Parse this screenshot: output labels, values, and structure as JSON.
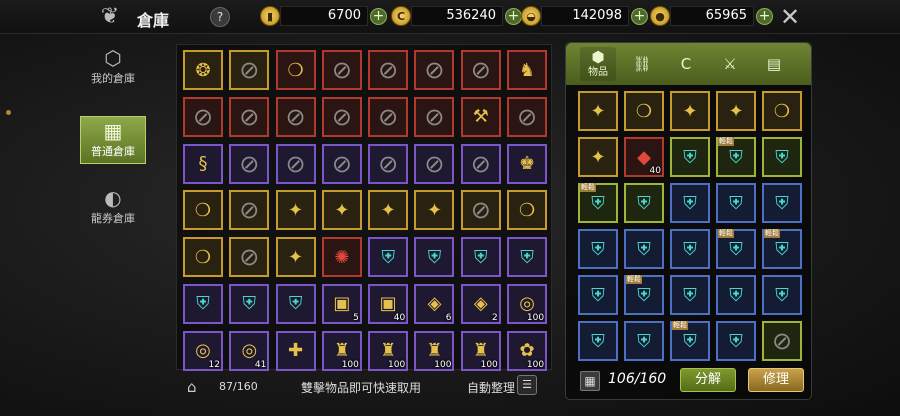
{
  "header": {
    "title": "倉庫",
    "help_label": "?",
    "close_label": "✕",
    "currencies": [
      {
        "icon": "gold-token-icon",
        "glyph": "▮",
        "value": "6700",
        "plus": "+"
      },
      {
        "icon": "c-coin-icon",
        "glyph": "C",
        "value": "536240",
        "plus": "+"
      },
      {
        "icon": "pouch-icon",
        "glyph": "◒",
        "value": "142098",
        "plus": "+"
      },
      {
        "icon": "gold-coin-icon",
        "glyph": "●",
        "value": "65965",
        "plus": "+"
      }
    ]
  },
  "sidebar": {
    "items": [
      {
        "label": "我的倉庫",
        "icon": "box-icon",
        "glyph": "⬡",
        "active": false
      },
      {
        "label": "普通倉庫",
        "icon": "warehouse-icon",
        "glyph": "▦",
        "active": true
      },
      {
        "label": "龍券倉庫",
        "icon": "dragon-coin-icon",
        "glyph": "◐",
        "active": false
      }
    ]
  },
  "storage": {
    "capacity": "87/160",
    "hint": "雙擊物品即可快速取用",
    "auto_sort": "自動整理",
    "home_glyph": "⌂",
    "list_glyph": "☰",
    "slots": [
      {
        "r": "gold",
        "g": "❂",
        "n": "armor-item"
      },
      {
        "r": "gold",
        "g": "⊘",
        "n": "unusable"
      },
      {
        "r": "red",
        "g": "❍",
        "n": "ring-item"
      },
      {
        "r": "red",
        "g": "⊘",
        "n": "unusable"
      },
      {
        "r": "red",
        "g": "⊘",
        "n": "unusable"
      },
      {
        "r": "red",
        "g": "⊘",
        "n": "unusable"
      },
      {
        "r": "red",
        "g": "⊘",
        "n": "unusable"
      },
      {
        "r": "red",
        "g": "♞",
        "n": "shoulder-item"
      },
      {
        "r": "red",
        "g": "⊘",
        "n": "unusable"
      },
      {
        "r": "red",
        "g": "⊘",
        "n": "unusable"
      },
      {
        "r": "red",
        "g": "⊘",
        "n": "unusable"
      },
      {
        "r": "red",
        "g": "⊘",
        "n": "unusable"
      },
      {
        "r": "red",
        "g": "⊘",
        "n": "unusable"
      },
      {
        "r": "red",
        "g": "⊘",
        "n": "unusable"
      },
      {
        "r": "red",
        "g": "⚒",
        "n": "axe-item"
      },
      {
        "r": "red",
        "g": "⊘",
        "n": "unusable"
      },
      {
        "r": "purple",
        "g": "§",
        "n": "earring-item"
      },
      {
        "r": "purple",
        "g": "⊘",
        "n": "unusable"
      },
      {
        "r": "purple",
        "g": "⊘",
        "n": "unusable"
      },
      {
        "r": "purple",
        "g": "⊘",
        "n": "unusable"
      },
      {
        "r": "purple",
        "g": "⊘",
        "n": "unusable"
      },
      {
        "r": "purple",
        "g": "⊘",
        "n": "unusable"
      },
      {
        "r": "purple",
        "g": "⊘",
        "n": "unusable"
      },
      {
        "r": "purple",
        "g": "♚",
        "n": "helm-item"
      },
      {
        "r": "gold",
        "g": "❍",
        "n": "ring-item"
      },
      {
        "r": "gold",
        "g": "⊘",
        "n": "unusable"
      },
      {
        "r": "gold",
        "g": "✦",
        "n": "earring-item"
      },
      {
        "r": "gold",
        "g": "✦",
        "n": "earring-item"
      },
      {
        "r": "gold",
        "g": "✦",
        "n": "earring-item"
      },
      {
        "r": "gold",
        "g": "✦",
        "n": "earring-item"
      },
      {
        "r": "gold",
        "g": "⊘",
        "n": "unusable"
      },
      {
        "r": "gold",
        "g": "❍",
        "n": "ring-item"
      },
      {
        "r": "gold",
        "g": "❍",
        "n": "ring-item"
      },
      {
        "r": "gold",
        "g": "⊘",
        "n": "unusable"
      },
      {
        "r": "gold",
        "g": "✦",
        "n": "earring-item"
      },
      {
        "r": "red",
        "g": "✺",
        "n": "orb-item"
      },
      {
        "r": "purple",
        "g": "⛨",
        "n": "jewel-item"
      },
      {
        "r": "purple",
        "g": "⛨",
        "n": "jewel-item"
      },
      {
        "r": "purple",
        "g": "⛨",
        "n": "jewel-item"
      },
      {
        "r": "purple",
        "g": "⛨",
        "n": "jewel-item"
      },
      {
        "r": "purple",
        "g": "⛨",
        "n": "jewel-item"
      },
      {
        "r": "purple",
        "g": "⛨",
        "n": "jewel-item"
      },
      {
        "r": "purple",
        "g": "⛨",
        "n": "jewel-item"
      },
      {
        "r": "purple",
        "g": "▣",
        "n": "chest-item",
        "q": "5"
      },
      {
        "r": "purple",
        "g": "▣",
        "n": "chest-item",
        "q": "40"
      },
      {
        "r": "purple",
        "g": "◈",
        "n": "gem-item",
        "q": "6"
      },
      {
        "r": "purple",
        "g": "◈",
        "n": "gem-item",
        "q": "2"
      },
      {
        "r": "purple",
        "g": "◎",
        "n": "shell-item",
        "q": "100"
      },
      {
        "r": "purple",
        "g": "◎",
        "n": "shell-item",
        "q": "12"
      },
      {
        "r": "purple",
        "g": "◎",
        "n": "shell-item",
        "q": "41"
      },
      {
        "r": "purple",
        "g": "✚",
        "n": "scroll-item"
      },
      {
        "r": "purple",
        "g": "♜",
        "n": "potion-item",
        "q": "100"
      },
      {
        "r": "purple",
        "g": "♜",
        "n": "potion-item",
        "q": "100"
      },
      {
        "r": "purple",
        "g": "♜",
        "n": "potion-item",
        "q": "100"
      },
      {
        "r": "purple",
        "g": "♜",
        "n": "potion-item",
        "q": "100"
      },
      {
        "r": "purple",
        "g": "✿",
        "n": "necklace-item",
        "q": "100"
      }
    ]
  },
  "inventory": {
    "capacity": "106/160",
    "decompose": "分解",
    "repair": "修理",
    "grid_glyph": "▦",
    "tabs": [
      {
        "label": "物品",
        "icon": "cube-icon",
        "glyph": "⬢"
      },
      {
        "label": "",
        "icon": "chain-icon",
        "glyph": "⛓"
      },
      {
        "label": "",
        "icon": "c-coin-icon",
        "glyph": "C"
      },
      {
        "label": "",
        "icon": "sword-icon",
        "glyph": "⚔"
      },
      {
        "label": "",
        "icon": "scroll-icon",
        "glyph": "▤"
      }
    ],
    "slots": [
      {
        "r": "gold",
        "g": "✦",
        "n": "earring-item"
      },
      {
        "r": "gold",
        "g": "❍",
        "n": "ring-item"
      },
      {
        "r": "gold",
        "g": "✦",
        "n": "earring-item"
      },
      {
        "r": "gold",
        "g": "✦",
        "n": "earring-item"
      },
      {
        "r": "gold",
        "g": "❍",
        "n": "ring-item"
      },
      {
        "r": "gold",
        "g": "✦",
        "n": "earring-item"
      },
      {
        "r": "red",
        "g": "◆",
        "n": "ruby-item",
        "q": "40"
      },
      {
        "r": "green",
        "g": "⛨",
        "n": "jewel-item"
      },
      {
        "r": "green",
        "g": "⛨",
        "n": "jewel-item",
        "t": "輕鬆"
      },
      {
        "r": "green",
        "g": "⛨",
        "n": "jewel-item"
      },
      {
        "r": "green",
        "g": "⛨",
        "n": "jewel-item",
        "t": "輕鬆"
      },
      {
        "r": "green",
        "g": "⛨",
        "n": "jewel-item"
      },
      {
        "r": "blue",
        "g": "⛨",
        "n": "jewel-item"
      },
      {
        "r": "blue",
        "g": "⛨",
        "n": "jewel-item"
      },
      {
        "r": "blue",
        "g": "⛨",
        "n": "jewel-item"
      },
      {
        "r": "blue",
        "g": "⛨",
        "n": "jewel-item"
      },
      {
        "r": "blue",
        "g": "⛨",
        "n": "jewel-item"
      },
      {
        "r": "blue",
        "g": "⛨",
        "n": "jewel-item"
      },
      {
        "r": "blue",
        "g": "⛨",
        "n": "jewel-item",
        "t": "輕鬆"
      },
      {
        "r": "blue",
        "g": "⛨",
        "n": "jewel-item",
        "t": "輕鬆"
      },
      {
        "r": "blue",
        "g": "⛨",
        "n": "jewel-item"
      },
      {
        "r": "blue",
        "g": "⛨",
        "n": "jewel-item",
        "t": "輕鬆"
      },
      {
        "r": "blue",
        "g": "⛨",
        "n": "jewel-item"
      },
      {
        "r": "blue",
        "g": "⛨",
        "n": "jewel-item"
      },
      {
        "r": "blue",
        "g": "⛨",
        "n": "jewel-item"
      },
      {
        "r": "blue",
        "g": "⛨",
        "n": "jewel-item"
      },
      {
        "r": "blue",
        "g": "⛨",
        "n": "jewel-item"
      },
      {
        "r": "blue",
        "g": "⛨",
        "n": "jewel-item",
        "t": "輕鬆"
      },
      {
        "r": "blue",
        "g": "⛨",
        "n": "jewel-item"
      },
      {
        "r": "green",
        "g": "⊘",
        "n": "unusable"
      }
    ]
  }
}
